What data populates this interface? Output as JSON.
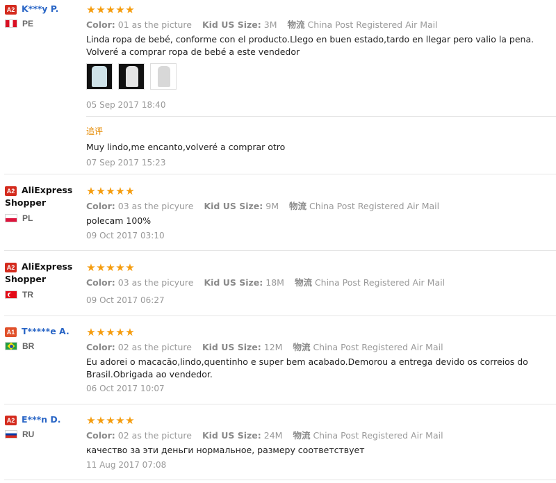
{
  "labels": {
    "color": "Color:",
    "size": "Kid US Size:",
    "shipping": "物流",
    "followup": "追评"
  },
  "star_icon": "★",
  "colors": {
    "star": "#f59c0d",
    "badge_a2": "#d42b1e",
    "badge_a1": "#e0502a",
    "name_link": "#2a66c6"
  },
  "reviews": [
    {
      "badge": "A2",
      "name": "K***y P.",
      "country": "PE",
      "rating": 5,
      "color": "01 as the picture",
      "size": "3M",
      "shipping": "China Post Registered Air Mail",
      "text": "Linda ropa de bebé, conforme con el producto.Llego en buen estado,tardo en llegar pero valio la pena. Volveré a comprar ropa de bebé a este vendedor",
      "date": "05 Sep 2017 18:40",
      "followup_text": "Muy lindo,me encanto,volveré a comprar otro",
      "followup_date": "07 Sep 2017 15:23"
    },
    {
      "badge": "A2",
      "name": "AliExpress",
      "name2": "Shopper",
      "country": "PL",
      "rating": 5,
      "color": "03 as the picyure",
      "size": "9M",
      "shipping": "China Post Registered Air Mail",
      "text": "polecam 100%",
      "date": "09 Oct 2017 03:10"
    },
    {
      "badge": "A2",
      "name": "AliExpress",
      "name2": "Shopper",
      "country": "TR",
      "rating": 5,
      "color": "03 as the picyure",
      "size": "18M",
      "shipping": "China Post Registered Air Mail",
      "date": "09 Oct 2017 06:27"
    },
    {
      "badge": "A1",
      "name": "T*****e A.",
      "country": "BR",
      "rating": 5,
      "color": "02 as the picture",
      "size": "12M",
      "shipping": "China Post Registered Air Mail",
      "text": "Eu adorei o macacão,lindo,quentinho e super bem acabado.Demorou a entrega devido os correios do Brasil.Obrigada ao vendedor.",
      "date": "06 Oct 2017 10:07"
    },
    {
      "badge": "A2",
      "name": "E***n D.",
      "country": "RU",
      "rating": 5,
      "color": "02 as the picture",
      "size": "24M",
      "shipping": "China Post Registered Air Mail",
      "text": "качество за эти деньги нормальное, размеру соответствует",
      "date": "11 Aug 2017 07:08"
    }
  ]
}
